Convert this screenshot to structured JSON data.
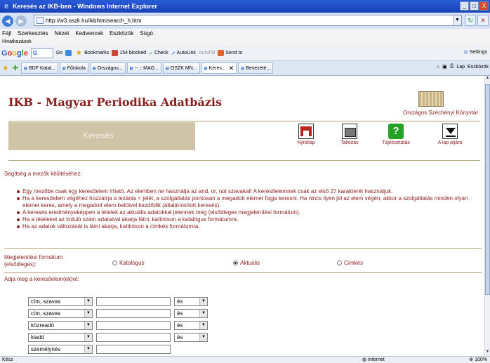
{
  "window": {
    "title": "Keresés az IKB-ben - Windows Internet Explorer",
    "controls": {
      "min": "_",
      "max": "□",
      "close": "X"
    }
  },
  "address": {
    "url": "http://w3.oszk.hu/ikbhtm/search_h.htm"
  },
  "menu": {
    "items": [
      "Fájl",
      "Szerkesztés",
      "Nézet",
      "Kedvencek",
      "Eszközök",
      "Súgó"
    ],
    "links_label": "Hivatkozások"
  },
  "googlebar": {
    "logo": [
      "G",
      "o",
      "o",
      "g",
      "l",
      "e"
    ],
    "search_letter": "G",
    "items": [
      "Go",
      "Bookmarks",
      "154 blocked",
      "Check",
      "AutoLink",
      "AutoFill",
      "Send to"
    ],
    "settings": "Settings"
  },
  "tabs": {
    "items": [
      "BDF Katal...",
      "Főiskola",
      "Országos...",
      "-- :: MAG...",
      "OSZK MN...",
      "Keres...",
      "Bevezeté..."
    ],
    "active_index": 5,
    "tools": [
      "Lap",
      "Eszközök"
    ]
  },
  "page": {
    "heading": "IKB - Magyar Periodika Adatbázis",
    "library": "Országos Széchényi Könyvtár",
    "section_title": "Keresés",
    "nav": [
      {
        "label": "Nyitólap"
      },
      {
        "label": "Tallózás"
      },
      {
        "label": "Tájékoztatás"
      },
      {
        "label": "A lap aljára"
      }
    ],
    "help_title": "Segítség a mezők kitöltéséhez:",
    "help_items": [
      "Egy mezőbe csak egy keresőelem írható. Az elemben ne használja az and, or, not szavakat! A keresőelemnek csak az első 27 karakterét használjuk.",
      "Ha a keresőelem végéhez hozzáírja a lezárás < jelét, a szolgáltatás pontosan a megadott elemet fogja keresni. Ha nincs ilyen jel az elem végén, akkor a szolgáltatás minden olyan elemet keres, amely a megadott elem betűivel kezdődik (általánosított keresés).",
      "A keresés eredményeképpen a tételek az aktuális adatokkal jelennek meg (elsődleges megjelenítési formátum).",
      "Ha a tételeket az induló szám adataival akarja látni, kattintson a katalógus formátumra.",
      "Ha az adatok változását is látni akarja, kattintson a címkés formátumra."
    ],
    "format_label": "Megjelenítési formátum (elsődleges):",
    "formats": [
      "Katalógus",
      "Aktuális",
      "Címkés"
    ],
    "format_selected": 1,
    "query_label": "Adja meg a keresőelem(ek)et:",
    "query_rows": [
      {
        "field": "cím, szavas",
        "value": "",
        "op": "és"
      },
      {
        "field": "cím, szavas",
        "value": "",
        "op": "és"
      },
      {
        "field": "közreadó",
        "value": "",
        "op": "és"
      },
      {
        "field": "kiadó",
        "value": "",
        "op": "és"
      },
      {
        "field": "személynév",
        "value": "",
        "op": ""
      }
    ]
  },
  "status": {
    "left": "Kész",
    "zone": "Internet",
    "zoom": "100%"
  }
}
